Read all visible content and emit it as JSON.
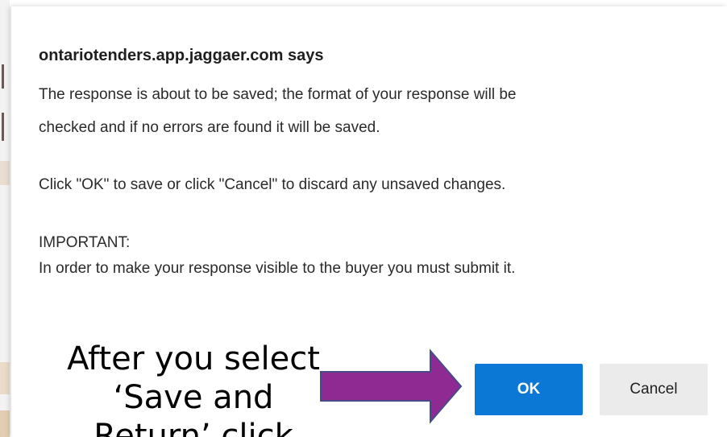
{
  "dialog": {
    "title": "ontariotenders.app.jaggaer.com says",
    "message_lines": [
      "The response is about to be saved; the format of your response will be",
      "checked and if no errors are found it will be saved.",
      "Click \"OK\" to save or click \"Cancel\" to discard any unsaved changes.",
      "IMPORTANT:",
      "In order to make your response visible to the buyer you must submit it."
    ],
    "ok_label": "OK",
    "cancel_label": "Cancel"
  },
  "annotation": {
    "lines": [
      "After you select",
      "‘Save and",
      "Return’ click"
    ],
    "arrow_color": "#8e2a91",
    "arrow_outline": "#4a4a8a"
  },
  "colors": {
    "ok_button": "#0a78d4",
    "cancel_button": "#ebebeb"
  }
}
